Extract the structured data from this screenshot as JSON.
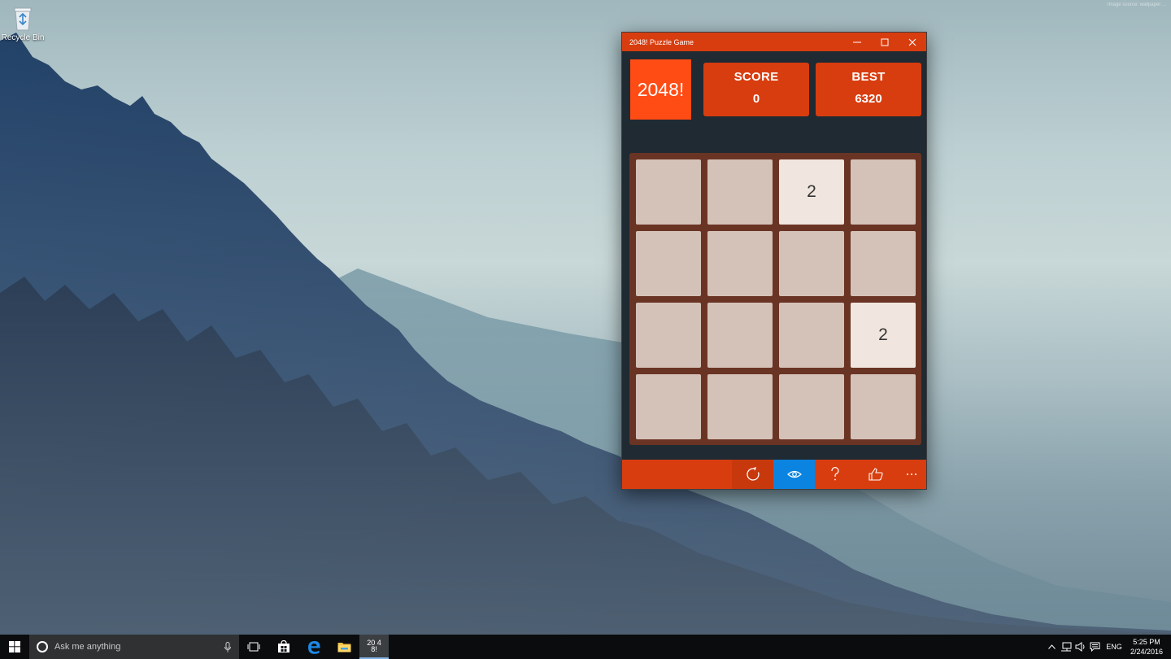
{
  "desktop": {
    "watermark": "Image source: wallpaper ...",
    "icons": [
      {
        "label": "Recycle Bin",
        "icon": "recycle-bin-icon"
      }
    ]
  },
  "window": {
    "title": "2048! Puzzle Game",
    "controls": [
      "minimize-icon",
      "maximize-icon",
      "close-icon"
    ],
    "accent_color": "#d83d0f"
  },
  "game": {
    "logo": "2048!",
    "score_label": "SCORE",
    "score_value": "0",
    "best_label": "BEST",
    "best_value": "6320",
    "board": [
      [
        "",
        "",
        "2",
        ""
      ],
      [
        "",
        "",
        "",
        ""
      ],
      [
        "",
        "",
        "",
        "2"
      ],
      [
        "",
        "",
        "",
        ""
      ]
    ]
  },
  "app_bar": {
    "buttons": [
      {
        "name": "restart",
        "icon": "restart-icon"
      },
      {
        "name": "view",
        "icon": "eye-icon",
        "active": true
      },
      {
        "name": "help",
        "icon": "question-icon"
      },
      {
        "name": "like",
        "icon": "thumbs-up-icon"
      },
      {
        "name": "more",
        "icon": "more-icon"
      }
    ]
  },
  "taskbar": {
    "search_placeholder": "Ask me anything",
    "pinned": [
      "task-view-icon",
      "store-icon",
      "edge-icon",
      "file-explorer-icon",
      "2048-app-icon"
    ],
    "app_2048_glyph": "20 48!",
    "tray": {
      "language": "ENG",
      "time": "5:25 PM",
      "date": "2/24/2016"
    }
  }
}
